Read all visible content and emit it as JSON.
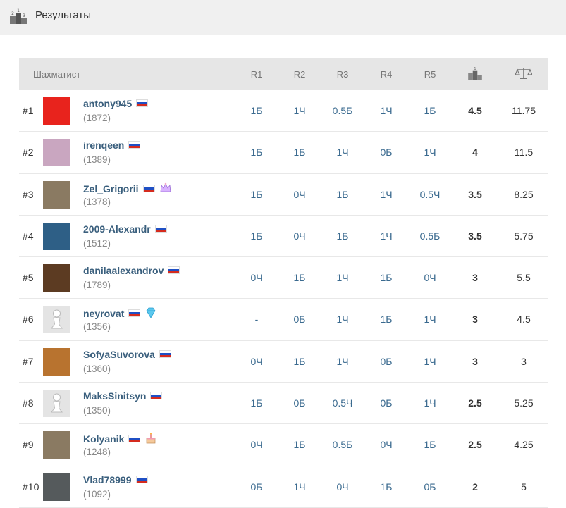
{
  "header": {
    "title": "Результаты",
    "icon": "podium-icon"
  },
  "table": {
    "columns": {
      "player": "Шахматист",
      "r1": "R1",
      "r2": "R2",
      "r3": "R3",
      "r4": "R4",
      "r5": "R5",
      "points_icon": "podium-icon",
      "tiebreak_icon": "scales-icon"
    },
    "rows": [
      {
        "rank": "#1",
        "name": "antony945",
        "rating": "(1872)",
        "r": [
          "1Б",
          "1Ч",
          "0.5Б",
          "1Ч",
          "1Б"
        ],
        "points": "4.5",
        "tiebreak": "11.75",
        "avatar_color": "#e8231d",
        "badge": ""
      },
      {
        "rank": "#2",
        "name": "irenqeen",
        "rating": "(1389)",
        "r": [
          "1Б",
          "1Б",
          "1Ч",
          "0Б",
          "1Ч"
        ],
        "points": "4",
        "tiebreak": "11.5",
        "avatar_color": "#c9a6c0",
        "badge": ""
      },
      {
        "rank": "#3",
        "name": "Zel_Grigorii",
        "rating": "(1378)",
        "r": [
          "1Б",
          "0Ч",
          "1Б",
          "1Ч",
          "0.5Ч"
        ],
        "points": "3.5",
        "tiebreak": "8.25",
        "avatar_color": "#8a7a62",
        "badge": "crown-icon"
      },
      {
        "rank": "#4",
        "name": "2009-Alexandr",
        "rating": "(1512)",
        "r": [
          "1Б",
          "0Ч",
          "1Б",
          "1Ч",
          "0.5Б"
        ],
        "points": "3.5",
        "tiebreak": "5.75",
        "avatar_color": "#2e5f86",
        "badge": ""
      },
      {
        "rank": "#5",
        "name": "danilaalexandrov",
        "rating": "(1789)",
        "r": [
          "0Ч",
          "1Б",
          "1Ч",
          "1Б",
          "0Ч"
        ],
        "points": "3",
        "tiebreak": "5.5",
        "avatar_color": "#5c3b22",
        "badge": ""
      },
      {
        "rank": "#6",
        "name": "neyrovat",
        "rating": "(1356)",
        "r": [
          "-",
          "0Б",
          "1Ч",
          "1Б",
          "1Ч"
        ],
        "points": "3",
        "tiebreak": "4.5",
        "avatar_color": "#e4e4e4",
        "badge": "diamond-icon"
      },
      {
        "rank": "#7",
        "name": "SofyaSuvorova",
        "rating": "(1360)",
        "r": [
          "0Ч",
          "1Б",
          "1Ч",
          "0Б",
          "1Ч"
        ],
        "points": "3",
        "tiebreak": "3",
        "avatar_color": "#b8732f",
        "badge": ""
      },
      {
        "rank": "#8",
        "name": "MaksSinitsyn",
        "rating": "(1350)",
        "r": [
          "1Б",
          "0Б",
          "0.5Ч",
          "0Б",
          "1Ч"
        ],
        "points": "2.5",
        "tiebreak": "5.25",
        "avatar_color": "#e4e4e4",
        "badge": ""
      },
      {
        "rank": "#9",
        "name": "Kolyanik",
        "rating": "(1248)",
        "r": [
          "0Ч",
          "1Б",
          "0.5Б",
          "0Ч",
          "1Б"
        ],
        "points": "2.5",
        "tiebreak": "4.25",
        "avatar_color": "#8a7a62",
        "badge": "cake-icon"
      },
      {
        "rank": "#10",
        "name": "Vlad78999",
        "rating": "(1092)",
        "r": [
          "0Б",
          "1Ч",
          "0Ч",
          "1Б",
          "0Б"
        ],
        "points": "2",
        "tiebreak": "5",
        "avatar_color": "#555a5c",
        "badge": ""
      }
    ]
  }
}
